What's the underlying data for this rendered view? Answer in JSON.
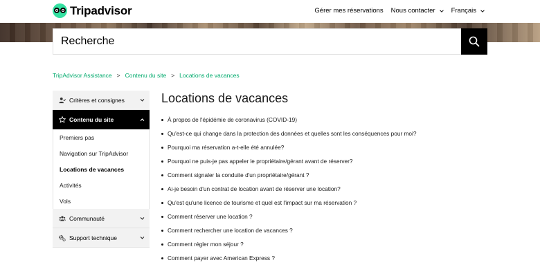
{
  "header": {
    "brand": "Tripadvisor",
    "nav": [
      {
        "label": "Gérer mes réservations",
        "dropdown": false
      },
      {
        "label": "Nous contacter",
        "dropdown": true
      },
      {
        "label": "Français",
        "dropdown": true
      }
    ]
  },
  "search": {
    "placeholder": "Recherche"
  },
  "breadcrumb": [
    "TripAdvisor Assistance",
    "Contenu du site",
    "Locations de vacances"
  ],
  "sidebar": {
    "sections": [
      {
        "label": "Critères et consignes",
        "icon": "user-check-icon",
        "expanded": false
      },
      {
        "label": "Contenu du site",
        "icon": "star-icon",
        "expanded": true,
        "items": [
          "Premiers pas",
          "Navigation sur TripAdvisor",
          "Locations de vacances",
          "Activités",
          "Vols"
        ],
        "current": "Locations de vacances"
      },
      {
        "label": "Communauté",
        "icon": "users-icon",
        "expanded": false
      },
      {
        "label": "Support technique",
        "icon": "gears-icon",
        "expanded": false
      }
    ]
  },
  "main": {
    "title": "Locations de vacances",
    "questions": [
      "À propos de l'épidémie de coronavirus (COVID-19)",
      "Qu'est-ce qui change dans la protection des données et quelles sont les conséquences pour moi?",
      "Pourquoi ma réservation a-t-elle été annulée?",
      "Pourquoi ne puis-je pas appeler le propriétaire/gérant avant de réserver?",
      "Comment signaler la conduite d'un propriétaire/gérant ?",
      "Ai-je besoin d'un contrat de location avant de réserver une location?",
      "Qu'est qu'une licence de tourisme et quel est l'impact sur ma réservation ?",
      "Comment réserver une location ?",
      "Comment rechercher une location de vacances ?",
      "Comment régler mon séjour ?",
      "Comment payer avec American Express ?"
    ]
  },
  "colors": {
    "accent": "#00aa6c",
    "brand": "#34e0a1",
    "sidebar_active_bg": "#000000",
    "sidebar_bg": "#f2f2f2"
  }
}
